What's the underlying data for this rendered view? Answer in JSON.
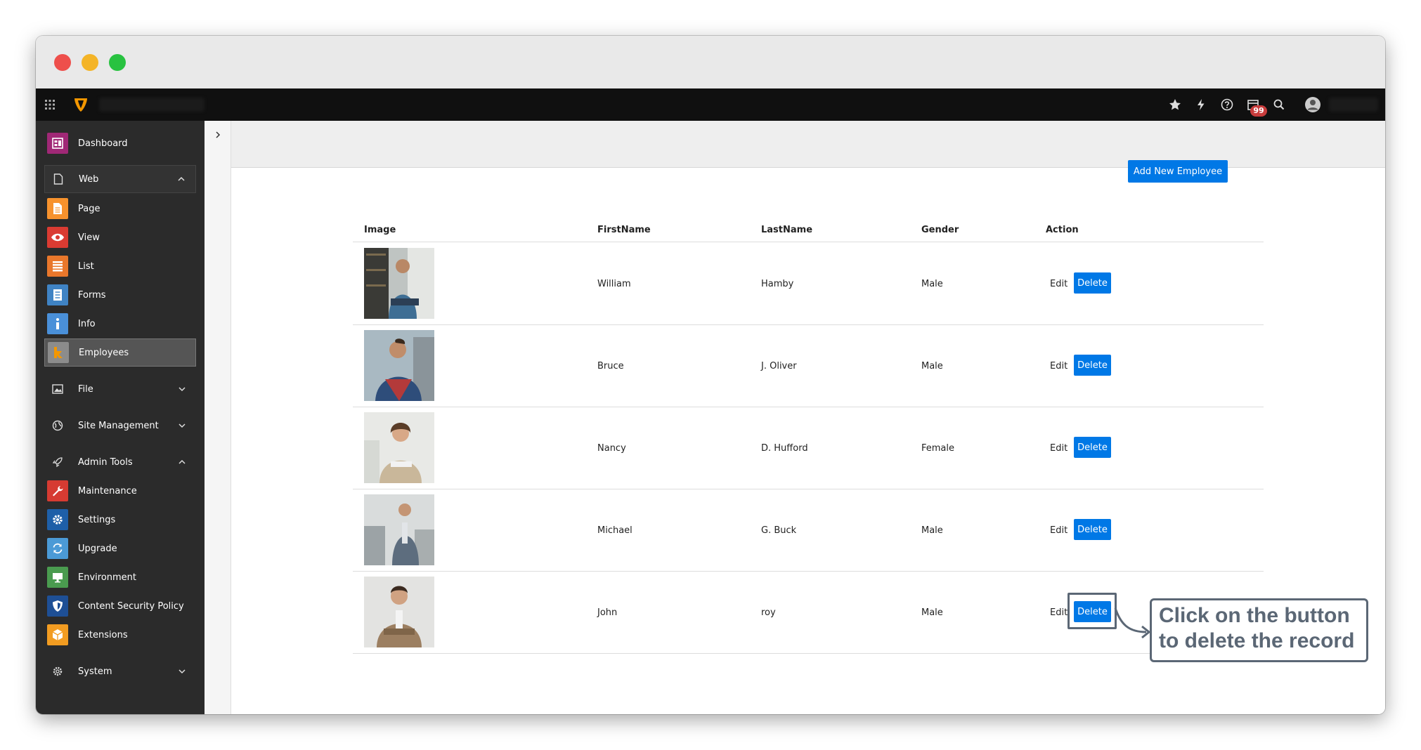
{
  "topbar": {
    "notification_count": "99",
    "icons": [
      "apps-grid-icon",
      "typo3-logo",
      "star-icon",
      "bolt-icon",
      "help-icon",
      "calendar-icon",
      "search-icon",
      "user-avatar-icon"
    ]
  },
  "sidebar": {
    "dashboard": "Dashboard",
    "web": "Web",
    "web_items": [
      "Page",
      "View",
      "List",
      "Forms",
      "Info",
      "Employees"
    ],
    "file": "File",
    "site_management": "Site Management",
    "admin_tools": "Admin Tools",
    "admin_items": [
      "Maintenance",
      "Settings",
      "Upgrade",
      "Environment",
      "Content Security Policy",
      "Extensions"
    ],
    "system": "System",
    "active_item": "Employees"
  },
  "main": {
    "add_button": "Add New Employee",
    "columns": [
      "Image",
      "FirstName",
      "LastName",
      "Gender",
      "Action"
    ],
    "edit_label": "Edit",
    "delete_label": "Delete",
    "rows": [
      {
        "first": "William",
        "last": "Hamby",
        "gender": "Male"
      },
      {
        "first": "Bruce",
        "last": "J. Oliver",
        "gender": "Male"
      },
      {
        "first": "Nancy",
        "last": "D. Hufford",
        "gender": "Female"
      },
      {
        "first": "Michael",
        "last": "G. Buck",
        "gender": "Male"
      },
      {
        "first": "John",
        "last": "roy",
        "gender": "Male"
      }
    ]
  },
  "callout": {
    "text": "Click on the button to delete the record"
  },
  "colors": {
    "accent_blue": "#0078e6",
    "sidebar_bg": "#2b2b2b",
    "topbar_bg": "#101010",
    "callout": "#5b6775"
  }
}
